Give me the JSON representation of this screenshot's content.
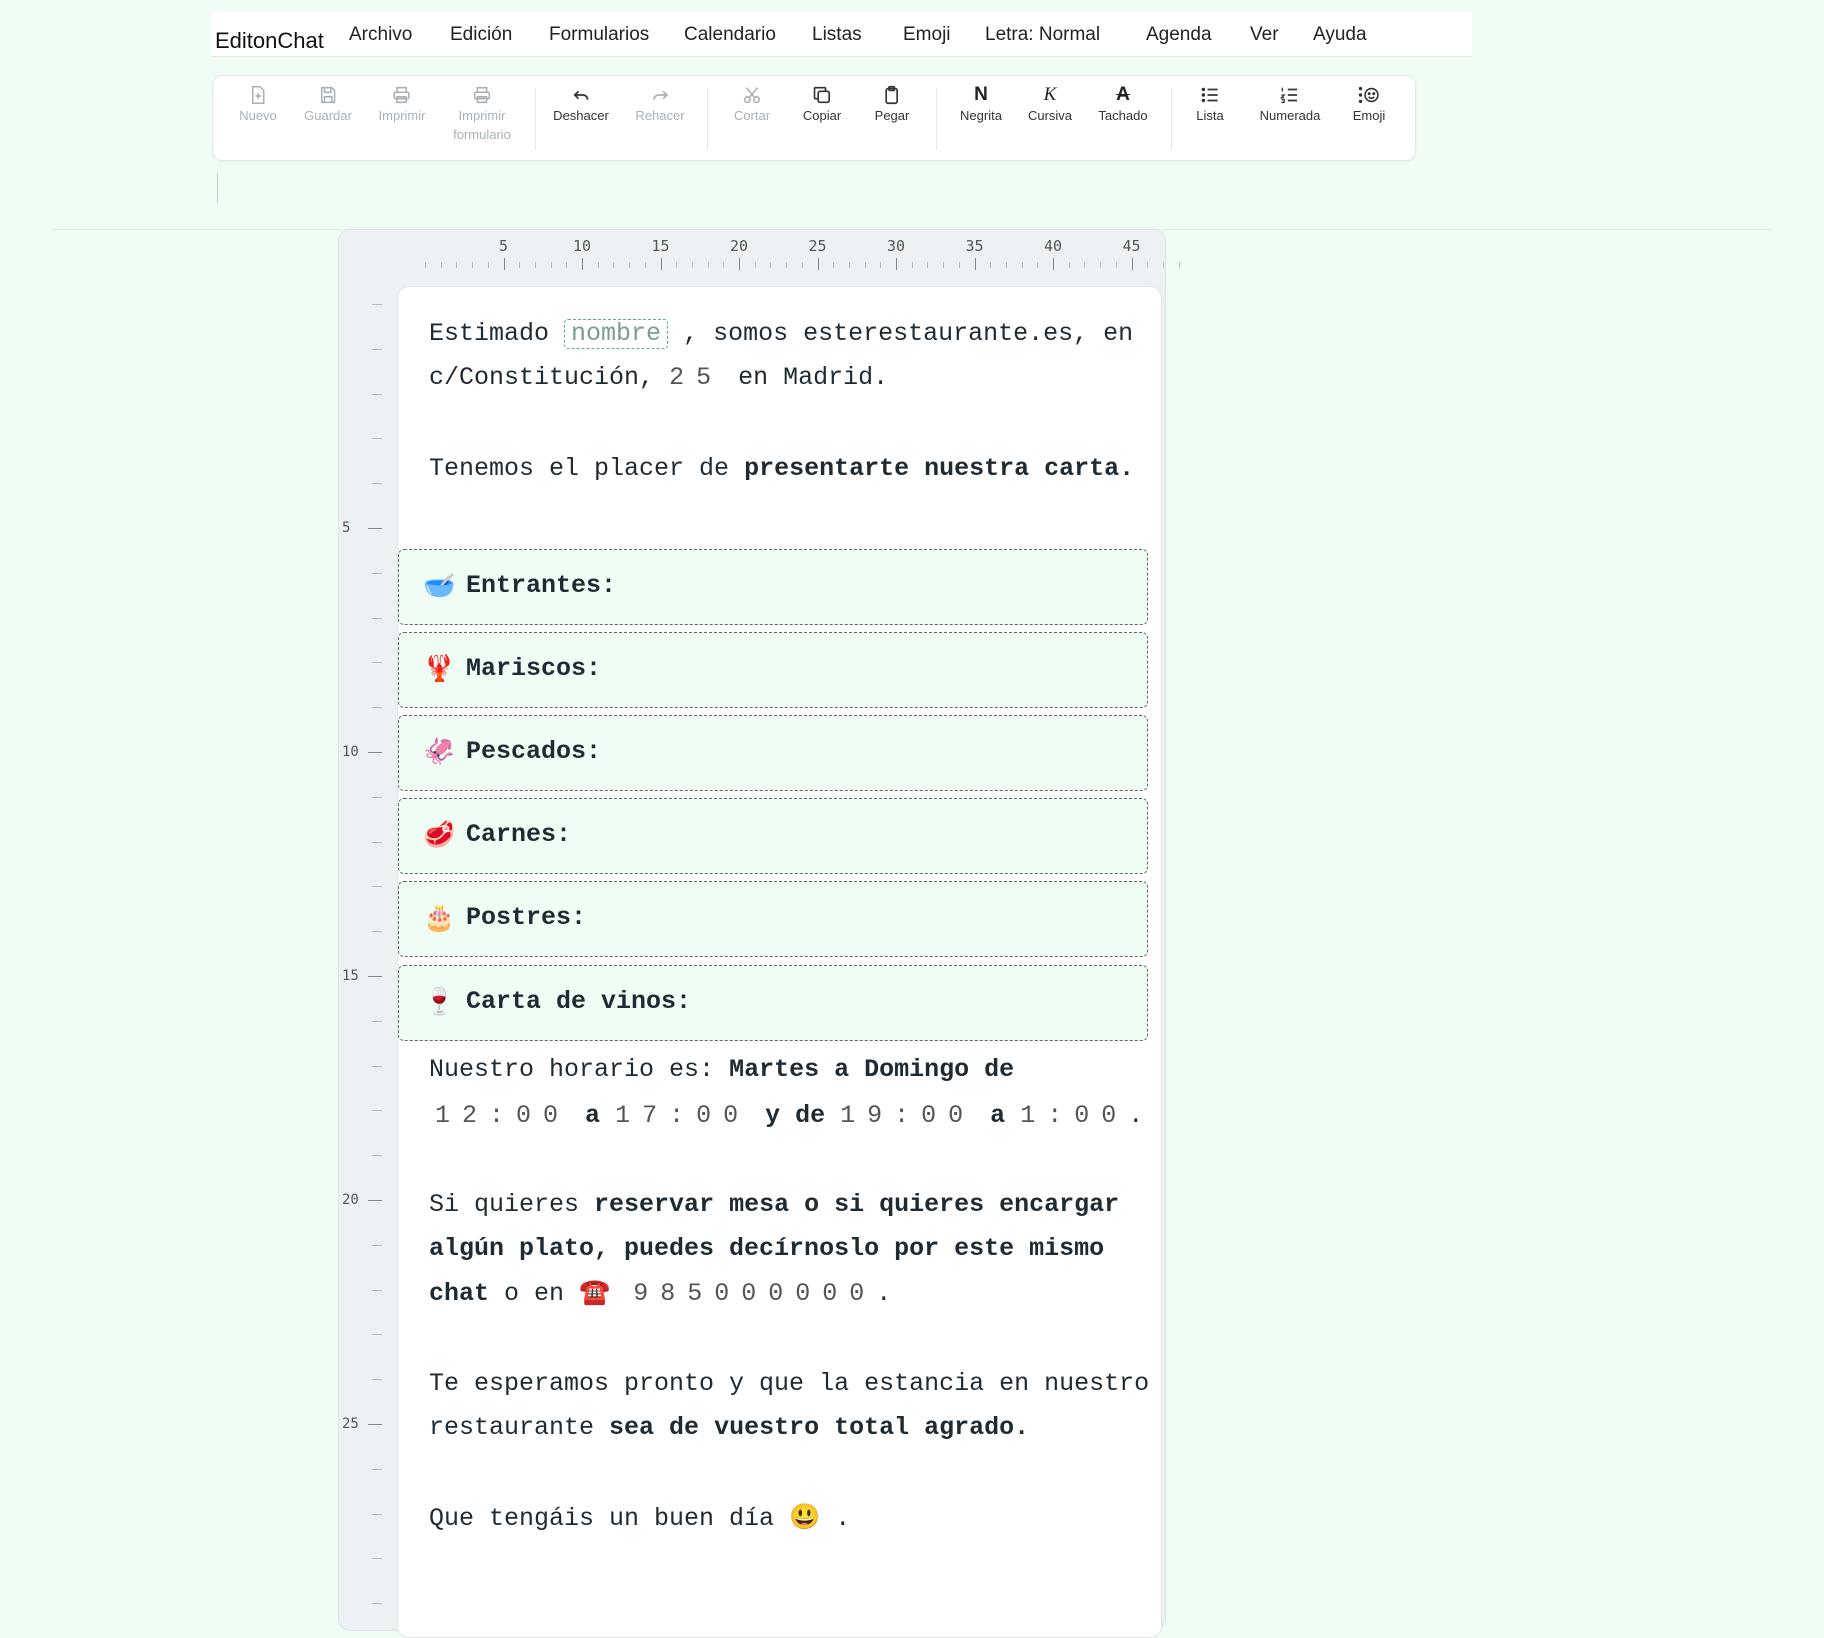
{
  "app": {
    "name": "EditonChat"
  },
  "menu": [
    {
      "label": "Archivo"
    },
    {
      "label": "Edición"
    },
    {
      "label": "Formularios"
    },
    {
      "label": "Calendario"
    },
    {
      "label": "Listas"
    },
    {
      "label": "Emoji"
    },
    {
      "label": "Letra: Normal"
    },
    {
      "label": "Agenda"
    },
    {
      "label": "Ver"
    },
    {
      "label": "Ayuda"
    }
  ],
  "toolbar": {
    "nuevo": {
      "label": "Nuevo",
      "icon": "new-file-icon",
      "disabled": true
    },
    "guardar": {
      "label": "Guardar",
      "icon": "save-icon",
      "disabled": true
    },
    "imprimir": {
      "label": "Imprimir",
      "icon": "printer-icon",
      "disabled": true
    },
    "imprimir_formulario": {
      "label": "Imprimir formulario",
      "icon": "printer-icon",
      "disabled": true
    },
    "deshacer": {
      "label": "Deshacer",
      "icon": "undo-icon",
      "disabled": false
    },
    "rehacer": {
      "label": "Rehacer",
      "icon": "redo-icon",
      "disabled": true
    },
    "cortar": {
      "label": "Cortar",
      "icon": "scissors-icon",
      "disabled": true
    },
    "copiar": {
      "label": "Copiar",
      "icon": "copy-icon",
      "disabled": false
    },
    "pegar": {
      "label": "Pegar",
      "icon": "clipboard-icon",
      "disabled": false
    },
    "negrita": {
      "label": "Negrita",
      "glyph": "N"
    },
    "cursiva": {
      "label": "Cursiva",
      "glyph": "K"
    },
    "tachado": {
      "label": "Tachado",
      "glyph": "A"
    },
    "lista": {
      "label": "Lista",
      "icon": "bullet-list-icon"
    },
    "numerada": {
      "label": "Numerada",
      "icon": "numbered-list-icon"
    },
    "emoji": {
      "label": "Emoji",
      "icon": "emoji-icon"
    }
  },
  "ruler": {
    "horizontal": [
      "5",
      "10",
      "15",
      "20",
      "25",
      "30",
      "35",
      "40",
      "45"
    ],
    "vertical": [
      "5",
      "10",
      "15",
      "20",
      "25"
    ]
  },
  "document": {
    "p1": {
      "a": "Estimado",
      "field_placeholder": "nombre",
      "b": ", somos esterestaurante.es, en",
      "c": "c/Constitución,",
      "num": "25",
      "d": "en Madrid."
    },
    "p2": {
      "a": "Tenemos el placer de",
      "bold": "presentarte nuestra carta."
    },
    "sections": [
      {
        "emoji": "🥣",
        "title": "Entrantes:"
      },
      {
        "emoji": "🦞",
        "title": "Mariscos:"
      },
      {
        "emoji": "🦑",
        "title": "Pescados:"
      },
      {
        "emoji": "🥩",
        "title": "Carnes:"
      },
      {
        "emoji": "🎂",
        "title": "Postres:"
      },
      {
        "emoji": "🍷",
        "title": "Carta de vinos:"
      }
    ],
    "p3": {
      "a": "Nuestro horario es:",
      "bold": "Martes a Domingo de",
      "t1": "12:00",
      "w1": "a",
      "t2": "17:00",
      "w2": "y de",
      "t3": "19:00",
      "w3": "a",
      "t4": "1:00",
      "end": "."
    },
    "p4": {
      "a": "Si quieres",
      "bold1": "reservar mesa o si quieres encargar",
      "bold2": "algún plato, puedes decírnoslo por este mismo",
      "bold3": "chat",
      "b": "o en",
      "phone_emoji": "☎️",
      "phone": "985000000",
      "end": "."
    },
    "p5": {
      "a": "Te esperamos pronto y que la estancia en nuestro",
      "b": "restaurante",
      "bold": "sea de vuestro total agrado."
    },
    "p6": {
      "a": "Que tengáis un buen día",
      "emoji": "😃",
      "end": "."
    }
  },
  "colors": {
    "background": "#f0fdf4",
    "section_bg": "#f0fdf4",
    "field_border": "#6aa884"
  }
}
